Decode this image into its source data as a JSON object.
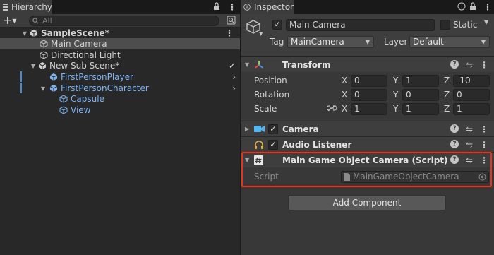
{
  "hierarchy": {
    "tab_label": "Hierarchy",
    "search_placeholder": "All",
    "add_label": "+",
    "items": [
      {
        "label": "SampleScene*",
        "depth": 0,
        "bold": true,
        "icon": "unity-scene-icon"
      },
      {
        "label": "Main Camera",
        "depth": 1,
        "selected": true,
        "icon": "gameobject-cube-icon"
      },
      {
        "label": "Directional Light",
        "depth": 1,
        "icon": "gameobject-cube-icon"
      },
      {
        "label": "New Sub Scene*",
        "depth": 1,
        "icon": "unity-scene-icon"
      },
      {
        "label": "FirstPersonPlayer",
        "depth": 2,
        "prefab": true,
        "icon": "prefab-cube-icon"
      },
      {
        "label": "FirstPersonCharacter",
        "depth": 2,
        "prefab": true,
        "icon": "prefab-cube-icon"
      },
      {
        "label": "Capsule",
        "depth": 3,
        "prefab": true,
        "icon": "gameobject-cube-icon"
      },
      {
        "label": "View",
        "depth": 3,
        "prefab": true,
        "icon": "gameobject-cube-icon"
      }
    ],
    "subscene_check": "✓"
  },
  "inspector": {
    "tab_label": "Inspector",
    "object_name": "Main Camera",
    "static_label": "Static",
    "tag_label": "Tag",
    "tag_value": "MainCamera",
    "layer_label": "Layer",
    "layer_value": "Default",
    "transform": {
      "title": "Transform",
      "rows": [
        {
          "label": "Position",
          "x": "0",
          "y": "1",
          "z": "-10"
        },
        {
          "label": "Rotation",
          "x": "0",
          "y": "0",
          "z": "0"
        },
        {
          "label": "Scale",
          "x": "1",
          "y": "1",
          "z": "1"
        }
      ],
      "axis_x": "X",
      "axis_y": "Y",
      "axis_z": "Z"
    },
    "components": [
      {
        "title": "Camera"
      },
      {
        "title": "Audio Listener"
      },
      {
        "title": "Main Game Object Camera (Script)"
      }
    ],
    "script_label": "Script",
    "script_value": "MainGameObjectCamera",
    "add_component": "Add Component"
  },
  "colors": {
    "accent_blue": "#7bb3f3",
    "highlight_red": "#e8321f",
    "camera_icon": "#52b7f0",
    "audio_icon": "#e0b14a"
  }
}
